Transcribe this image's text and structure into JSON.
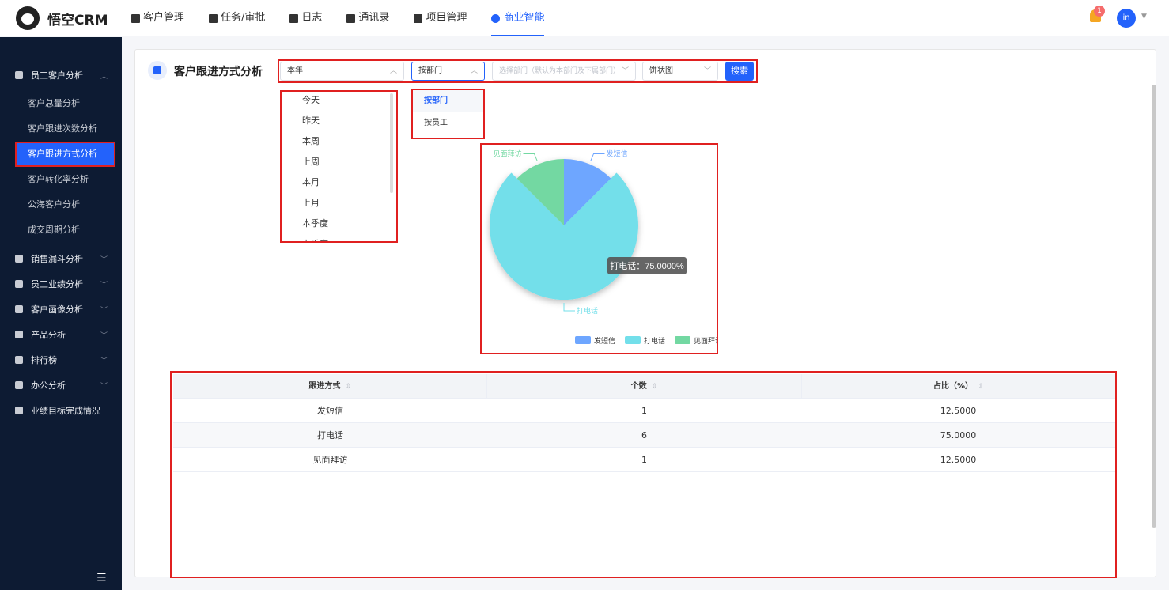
{
  "app": {
    "brand": "悟空CRM"
  },
  "nav": [
    {
      "label": "客户管理"
    },
    {
      "label": "任务/审批"
    },
    {
      "label": "日志"
    },
    {
      "label": "通讯录"
    },
    {
      "label": "项目管理"
    },
    {
      "label": "商业智能"
    }
  ],
  "header": {
    "notification_count": "1",
    "avatar_text": "in"
  },
  "sidebar": {
    "groups": [
      {
        "label": "员工客户分析"
      },
      {
        "label": "销售漏斗分析"
      },
      {
        "label": "员工业绩分析"
      },
      {
        "label": "客户画像分析"
      },
      {
        "label": "产品分析"
      },
      {
        "label": "排行榜"
      },
      {
        "label": "办公分析"
      },
      {
        "label": "业绩目标完成情况"
      }
    ],
    "sub_items": [
      {
        "label": "客户总量分析"
      },
      {
        "label": "客户跟进次数分析"
      },
      {
        "label": "客户跟进方式分析"
      },
      {
        "label": "客户转化率分析"
      },
      {
        "label": "公海客户分析"
      },
      {
        "label": "成交周期分析"
      }
    ],
    "toggle_icon": "menu-collapse-icon"
  },
  "page": {
    "title": "客户跟进方式分析"
  },
  "filters": {
    "period_value": "本年",
    "scope_value": "按部门",
    "dept_placeholder": "选择部门（默认为本部门及下属部门）",
    "chart_type_value": "饼状图",
    "search_label": "搜索"
  },
  "period_options": [
    "今天",
    "昨天",
    "本周",
    "上周",
    "本月",
    "上月",
    "本季度",
    "上季度"
  ],
  "scope_options": [
    "按部门",
    "按员工"
  ],
  "colors": {
    "accent": "#2362fb",
    "sms": "#6ea6ff",
    "phone": "#73dfea",
    "visit": "#73d8a2",
    "highlight": "#e02020"
  },
  "chart_data": {
    "type": "pie",
    "slices": [
      {
        "name": "发短信",
        "value": 12.5,
        "color": "#6ea6ff"
      },
      {
        "name": "打电话",
        "value": 75.0,
        "color": "#73dfea"
      },
      {
        "name": "见面拜访",
        "value": 12.5,
        "color": "#73d8a2"
      }
    ],
    "tooltip": "打电话：75.0000%",
    "legend": [
      "发短信",
      "打电话",
      "见面拜访"
    ],
    "legend_position": "bottom-right"
  },
  "table": {
    "columns": [
      "跟进方式",
      "个数",
      "占比（%）"
    ],
    "rows": [
      [
        "发短信",
        "1",
        "12.5000"
      ],
      [
        "打电话",
        "6",
        "75.0000"
      ],
      [
        "见面拜访",
        "1",
        "12.5000"
      ]
    ]
  }
}
